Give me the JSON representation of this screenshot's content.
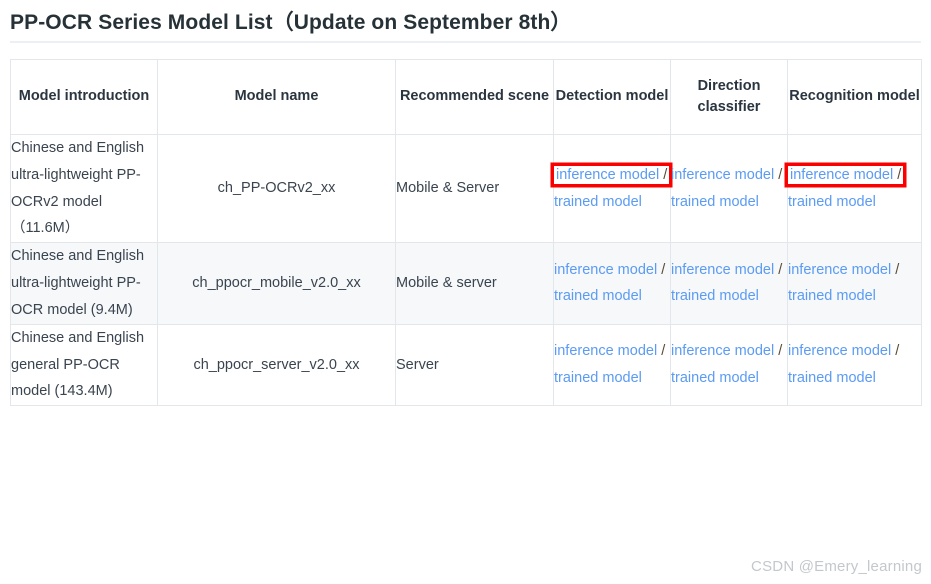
{
  "page": {
    "title": "PP-OCR Series Model List（Update on September 8th）",
    "watermark": "CSDN @Emery_learning"
  },
  "table": {
    "columns": [
      {
        "key": "introduction",
        "label": "Model introduction"
      },
      {
        "key": "name",
        "label": "Model name"
      },
      {
        "key": "scene",
        "label": "Recommended scene"
      },
      {
        "key": "detection",
        "label": "Detection model"
      },
      {
        "key": "direction",
        "label": "Direction classifier"
      },
      {
        "key": "recognition",
        "label": "Recognition model"
      }
    ],
    "link_labels": {
      "inference": "inference model",
      "separator": "/",
      "trained": "trained model"
    },
    "rows": [
      {
        "introduction": "Chinese and English ultra-lightweight PP-OCRv2 model（11.6M）",
        "name": "ch_PP-OCRv2_xx",
        "scene": "Mobile & Server",
        "detection": {
          "inference": "inference model",
          "trained": "trained model",
          "highlighted": true
        },
        "direction": {
          "inference": "inference model",
          "trained": "trained model",
          "highlighted": false
        },
        "recognition": {
          "inference": "inference model",
          "trained": "trained model",
          "highlighted": true
        }
      },
      {
        "introduction": "Chinese and English ultra-lightweight PP-OCR model (9.4M)",
        "name": "ch_ppocr_mobile_v2.0_xx",
        "scene": "Mobile & server",
        "detection": {
          "inference": "inference model",
          "trained": "trained model",
          "highlighted": false
        },
        "direction": {
          "inference": "inference model",
          "trained": "trained model",
          "highlighted": false
        },
        "recognition": {
          "inference": "inference model",
          "trained": "trained model",
          "highlighted": false
        }
      },
      {
        "introduction": "Chinese and English general PP-OCR model (143.4M)",
        "name": "ch_ppocr_server_v2.0_xx",
        "scene": "Server",
        "detection": {
          "inference": "inference model",
          "trained": "trained model",
          "highlighted": false
        },
        "direction": {
          "inference": "inference model",
          "trained": "trained model",
          "highlighted": false
        },
        "recognition": {
          "inference": "inference model",
          "trained": "trained model",
          "highlighted": false
        }
      }
    ]
  },
  "colors": {
    "link": "#5b9bf3",
    "highlight_box": "#fb0000",
    "alt_row": "#f6f8fa",
    "border": "#e3e7ec",
    "watermark": "#c3c8cd"
  }
}
